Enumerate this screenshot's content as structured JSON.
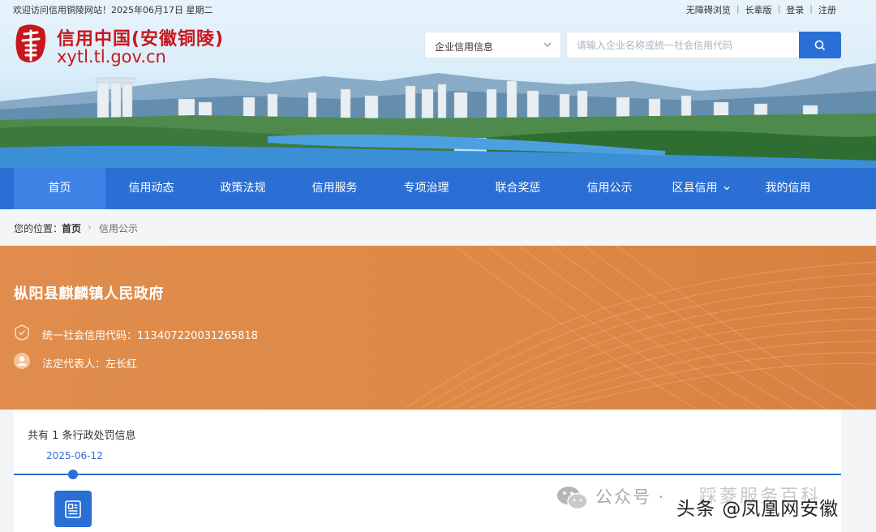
{
  "topbar": {
    "welcome": "欢迎访问信用铜陵网站！2025年06月17日 星期二",
    "links": [
      "无障碍浏览",
      "长辈版",
      "登录",
      "注册"
    ]
  },
  "logo": {
    "title": "信用中国(安徽铜陵)",
    "domain": "xytl.tl.gov.cn",
    "mark_icon": "xin-seal-logo"
  },
  "search": {
    "category": "企业信用信息",
    "placeholder": "请输入企业名称或统一社会信用代码",
    "button_icon": "search-icon"
  },
  "nav": {
    "items": [
      "首页",
      "信用动态",
      "政策法规",
      "信用服务",
      "专项治理",
      "联合奖惩",
      "信用公示",
      "区县信用",
      "我的信用"
    ],
    "active_index": 0
  },
  "breadcrumb": {
    "prefix": "您的位置：",
    "home": "首页",
    "separator": "›",
    "current": "信用公示"
  },
  "hero": {
    "org_name": "枞阳县麒麟镇人民政府",
    "credit_code_label": "统一社会信用代码：",
    "credit_code": "11340722003126581​8",
    "legal_rep_label": "法定代表人：",
    "legal_rep": "左长红"
  },
  "records": {
    "count_text": "共有 1 条行政处罚信息",
    "timeline": [
      {
        "date": "2025-06-12"
      }
    ]
  },
  "watermark": {
    "gzh": "公众号 ·",
    "faded": "踩菱服务百科",
    "main": "头条 @凤凰网安徽"
  },
  "colors": {
    "brand_red": "#c8161d",
    "nav_blue": "#2b6fd4",
    "nav_active": "#3f82e6",
    "hero_orange": "#dd8a47"
  }
}
